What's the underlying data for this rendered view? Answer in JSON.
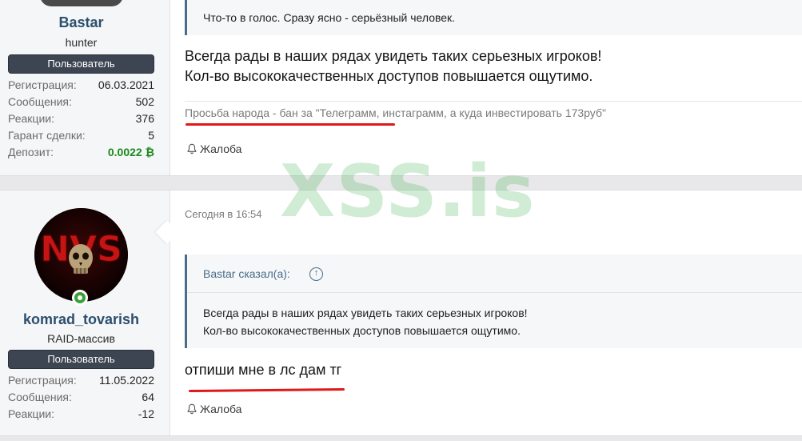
{
  "watermark": "XSS.is",
  "colors": {
    "accent": "#4a6d8c",
    "deposit": "#1b8a1b",
    "badge": "#3d4452",
    "highlight": "#e01818",
    "online": "#3aa13a"
  },
  "posts": [
    {
      "user": {
        "name": "Bastar",
        "title": "hunter",
        "role": "Пользователь",
        "stats": [
          {
            "label": "Регистрация:",
            "value": "06.03.2021"
          },
          {
            "label": "Сообщения:",
            "value": "502"
          },
          {
            "label": "Реакции:",
            "value": "376"
          },
          {
            "label": "Гарант сделки:",
            "value": "5"
          },
          {
            "label": "Депозит:",
            "value": "0.0022 ₿"
          }
        ]
      },
      "quote": "Что-то в голос. Сразу ясно - серьёзный человек.",
      "message_lines": [
        "Всегда рады в наших рядах увидеть таких серьезных игроков!",
        "Кол-во высококачественных доступов повышается ощутимо."
      ],
      "signature": "Просьба народа - бан за \"Телеграмм, инстаграмм, а куда инвестировать 173руб\"",
      "report_label": "Жалоба",
      "report_icon": "bell-icon"
    },
    {
      "timestamp": "Сегодня в 16:54",
      "user": {
        "name": "komrad_tovarish",
        "title": "RAID-массив",
        "role": "Пользователь",
        "avatar_text": "NVS",
        "stats": [
          {
            "label": "Регистрация:",
            "value": "11.05.2022"
          },
          {
            "label": "Сообщения:",
            "value": "64"
          },
          {
            "label": "Реакции:",
            "value": "-12"
          }
        ]
      },
      "quote": {
        "author": "Bastar сказал(а):",
        "jump_icon": "arrow-up-circle-icon",
        "lines": [
          "Всегда рады в наших рядах увидеть таких серьезных игроков!",
          "Кол-во высококачественных доступов повышается ощутимо."
        ]
      },
      "message": "отпиши мне в лс дам тг",
      "report_label": "Жалоба",
      "report_icon": "bell-icon"
    }
  ]
}
